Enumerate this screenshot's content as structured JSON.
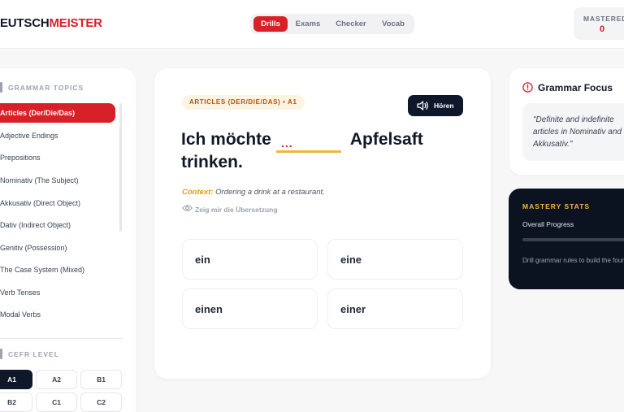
{
  "logo": {
    "part1": "EUTSCH",
    "part2": "MEISTER"
  },
  "modes": [
    {
      "label": "Drills",
      "active": true
    },
    {
      "label": "Exams",
      "active": false
    },
    {
      "label": "Checker",
      "active": false
    },
    {
      "label": "Vocab",
      "active": false
    }
  ],
  "mastered": {
    "label": "MASTERED",
    "value": "0"
  },
  "sidebar": {
    "topics_title": "GRAMMAR TOPICS",
    "topics": [
      "Articles (Der/Die/Das)",
      "Adjective Endings",
      "Prepositions",
      "Nominativ (The Subject)",
      "Akkusativ (Direct Object)",
      "Dativ (Indirect Object)",
      "Genitiv (Possession)",
      "The Case System (Mixed)",
      "Verb Tenses",
      "Modal Verbs"
    ],
    "active_topic": 0,
    "cefr_title": "CEFR LEVEL",
    "cefr_levels": [
      "A1",
      "A2",
      "B1",
      "B2",
      "C1",
      "C2"
    ],
    "active_level": "A1"
  },
  "exercise": {
    "badge": "ARTICLES (DER/DIE/DAS) • A1",
    "listen_label": "Hören",
    "sentence_start": "Ich möchte",
    "blank": "...",
    "sentence_mid": "Apfelsaft",
    "sentence_end": "trinken.",
    "context_label": "Context:",
    "context_text": "Ordering a drink at a restaurant.",
    "translate_label": "Zeig mir die Übersetzung",
    "options": [
      "ein",
      "eine",
      "einen",
      "einer"
    ]
  },
  "focus": {
    "title": "Grammar Focus",
    "quote": "\"Definite and indefinite articles in Nominativ and Akkusativ.\""
  },
  "stats": {
    "title": "MASTERY STATS",
    "progress_label": "Overall Progress",
    "progress_value": 0,
    "description": "Drill grammar rules to build the foundation for complex writing."
  },
  "colors": {
    "accent": "#d72027",
    "dark": "#0f172a",
    "gold": "#f2b63c"
  }
}
